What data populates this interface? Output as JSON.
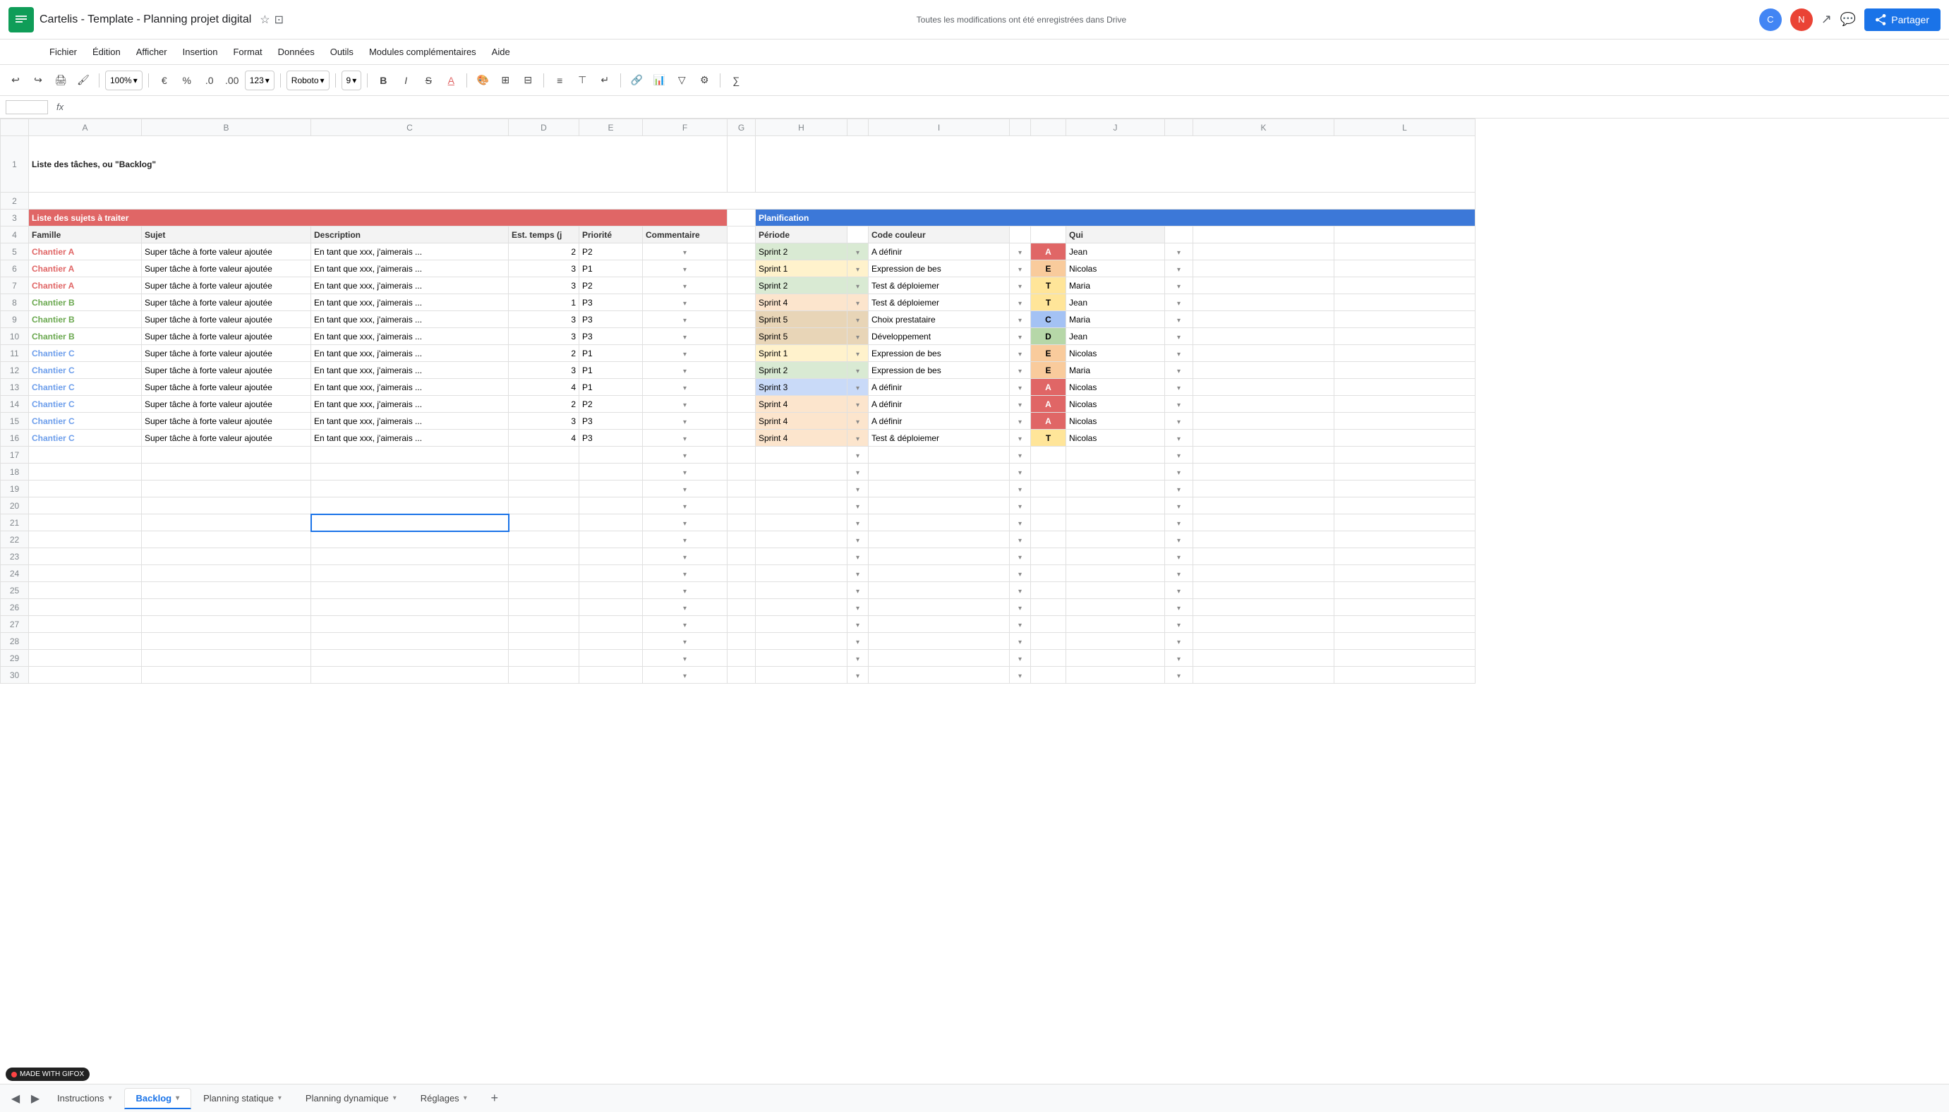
{
  "app": {
    "icon": "≡",
    "title": "Cartelis  -  Template - Planning projet digital",
    "autosave": "Toutes les modifications ont été enregistrées dans Drive",
    "share_label": "Partager"
  },
  "menu": {
    "items": [
      "Fichier",
      "Édition",
      "Afficher",
      "Insertion",
      "Format",
      "Données",
      "Outils",
      "Modules complémentaires",
      "Aide"
    ]
  },
  "toolbar": {
    "zoom": "100%",
    "font": "Roboto",
    "font_size": "9"
  },
  "formula_bar": {
    "cell_ref": "",
    "fx": "fx"
  },
  "sheet": {
    "title": "Liste des tâches, ou \"Backlog\"",
    "section1_label": "Liste des sujets à traiter",
    "section2_label": "Planification",
    "col_headers": {
      "famille": "Famille",
      "sujet": "Sujet",
      "description": "Description",
      "est_temps": "Est. temps (j",
      "priorite": "Priorité",
      "commentaire": "Commentaire",
      "periode": "Période",
      "code_couleur": "Code couleur",
      "qui": "Qui"
    },
    "rows": [
      {
        "famille": "Chantier A",
        "sujet": "Super tâche à forte valeur ajoutée",
        "description": "En tant que xxx, j'aimerais ...",
        "est_temps": "2",
        "priorite": "P2",
        "sprint": "Sprint 2",
        "code_label": "A définir",
        "code": "A",
        "qui": "Jean"
      },
      {
        "famille": "Chantier A",
        "sujet": "Super tâche à forte valeur ajoutée",
        "description": "En tant que xxx, j'aimerais ...",
        "est_temps": "3",
        "priorite": "P1",
        "sprint": "Sprint 1",
        "code_label": "Expression de bes",
        "code": "E",
        "qui": "Nicolas"
      },
      {
        "famille": "Chantier A",
        "sujet": "Super tâche à forte valeur ajoutée",
        "description": "En tant que xxx, j'aimerais ...",
        "est_temps": "3",
        "priorite": "P2",
        "sprint": "Sprint 2",
        "code_label": "Test & déploiemer",
        "code": "T",
        "qui": "Maria"
      },
      {
        "famille": "Chantier B",
        "sujet": "Super tâche à forte valeur ajoutée",
        "description": "En tant que xxx, j'aimerais ...",
        "est_temps": "1",
        "priorite": "P3",
        "sprint": "Sprint 4",
        "code_label": "Test & déploiemer",
        "code": "T",
        "qui": "Jean"
      },
      {
        "famille": "Chantier B",
        "sujet": "Super tâche à forte valeur ajoutée",
        "description": "En tant que xxx, j'aimerais ...",
        "est_temps": "3",
        "priorite": "P3",
        "sprint": "Sprint 5",
        "code_label": "Choix prestataire",
        "code": "C",
        "qui": "Maria"
      },
      {
        "famille": "Chantier B",
        "sujet": "Super tâche à forte valeur ajoutée",
        "description": "En tant que xxx, j'aimerais ...",
        "est_temps": "3",
        "priorite": "P3",
        "sprint": "Sprint 5",
        "code_label": "Développement",
        "code": "D",
        "qui": "Jean"
      },
      {
        "famille": "Chantier C",
        "sujet": "Super tâche à forte valeur ajoutée",
        "description": "En tant que xxx, j'aimerais ...",
        "est_temps": "2",
        "priorite": "P1",
        "sprint": "Sprint 1",
        "code_label": "Expression de bes",
        "code": "E",
        "qui": "Nicolas"
      },
      {
        "famille": "Chantier C",
        "sujet": "Super tâche à forte valeur ajoutée",
        "description": "En tant que xxx, j'aimerais ...",
        "est_temps": "3",
        "priorite": "P1",
        "sprint": "Sprint 2",
        "code_label": "Expression de bes",
        "code": "E",
        "qui": "Maria"
      },
      {
        "famille": "Chantier C",
        "sujet": "Super tâche à forte valeur ajoutée",
        "description": "En tant que xxx, j'aimerais ...",
        "est_temps": "4",
        "priorite": "P1",
        "sprint": "Sprint 3",
        "code_label": "A définir",
        "code": "A",
        "qui": "Nicolas"
      },
      {
        "famille": "Chantier C",
        "sujet": "Super tâche à forte valeur ajoutée",
        "description": "En tant que xxx, j'aimerais ...",
        "est_temps": "2",
        "priorite": "P2",
        "sprint": "Sprint 4",
        "code_label": "A définir",
        "code": "A",
        "qui": "Nicolas"
      },
      {
        "famille": "Chantier C",
        "sujet": "Super tâche à forte valeur ajoutée",
        "description": "En tant que xxx, j'aimerais ...",
        "est_temps": "3",
        "priorite": "P3",
        "sprint": "Sprint 4",
        "code_label": "A définir",
        "code": "A",
        "qui": "Nicolas"
      },
      {
        "famille": "Chantier C",
        "sujet": "Super tâche à forte valeur ajoutée",
        "description": "En tant que xxx, j'aimerais ...",
        "est_temps": "4",
        "priorite": "P3",
        "sprint": "Sprint 4",
        "code_label": "Test & déploiemer",
        "code": "T",
        "qui": "Nicolas"
      }
    ],
    "empty_rows_count": 15
  },
  "tabs": {
    "items": [
      {
        "label": "Instructions",
        "active": false
      },
      {
        "label": "Backlog",
        "active": true
      },
      {
        "label": "Planning statique",
        "active": false
      },
      {
        "label": "Planning dynamique",
        "active": false
      },
      {
        "label": "Réglages",
        "active": false
      }
    ]
  },
  "colors": {
    "red_header": "#e06666",
    "blue_header": "#3c78d8",
    "active_tab": "#1a73e8",
    "selected_cell": "#1a73e8"
  }
}
